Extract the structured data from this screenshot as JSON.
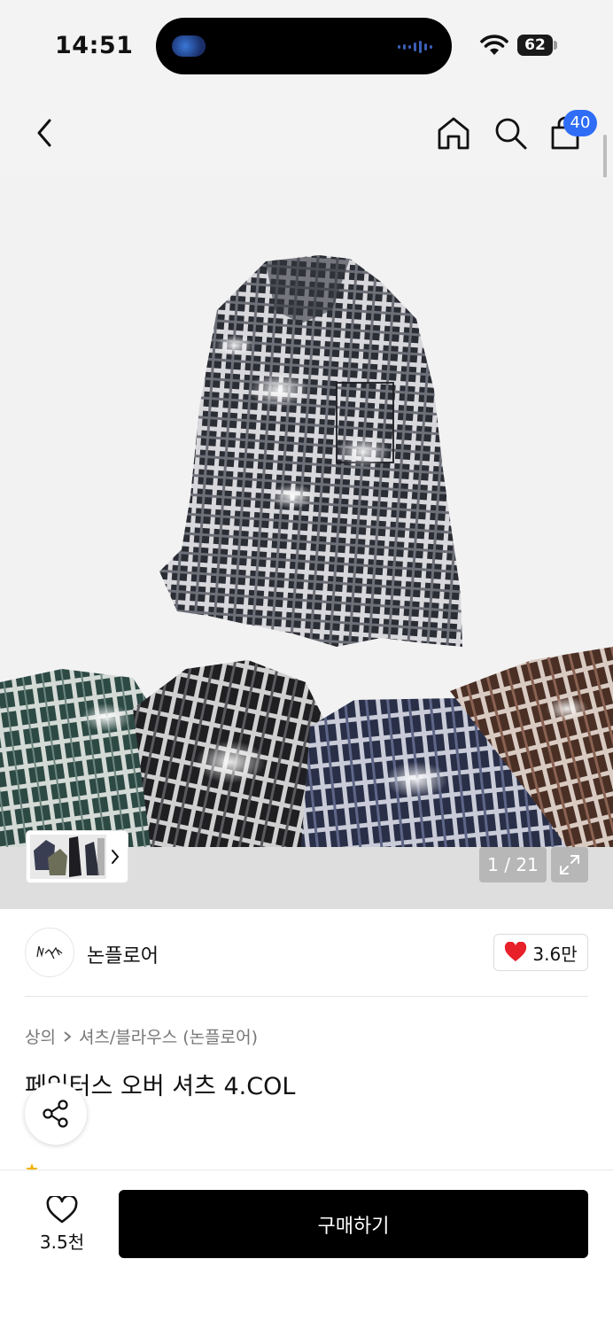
{
  "status_bar": {
    "time": "14:51",
    "battery": "62"
  },
  "nav": {
    "cart_badge": "40"
  },
  "gallery": {
    "counter": "1 / 21"
  },
  "brand": {
    "name": "논플로어",
    "likes": "3.6만"
  },
  "breadcrumb": {
    "category": "상의",
    "subcategory": "셔츠/블라우스 (논플로어)"
  },
  "product": {
    "title": "페인터스 오버 셔츠 4.COL"
  },
  "bottom_bar": {
    "wish_count": "3.5천",
    "buy_label": "구매하기"
  },
  "colors": {
    "accent_blue": "#2f6df6",
    "heart_red": "#e8202a",
    "buy_black": "#000000"
  }
}
